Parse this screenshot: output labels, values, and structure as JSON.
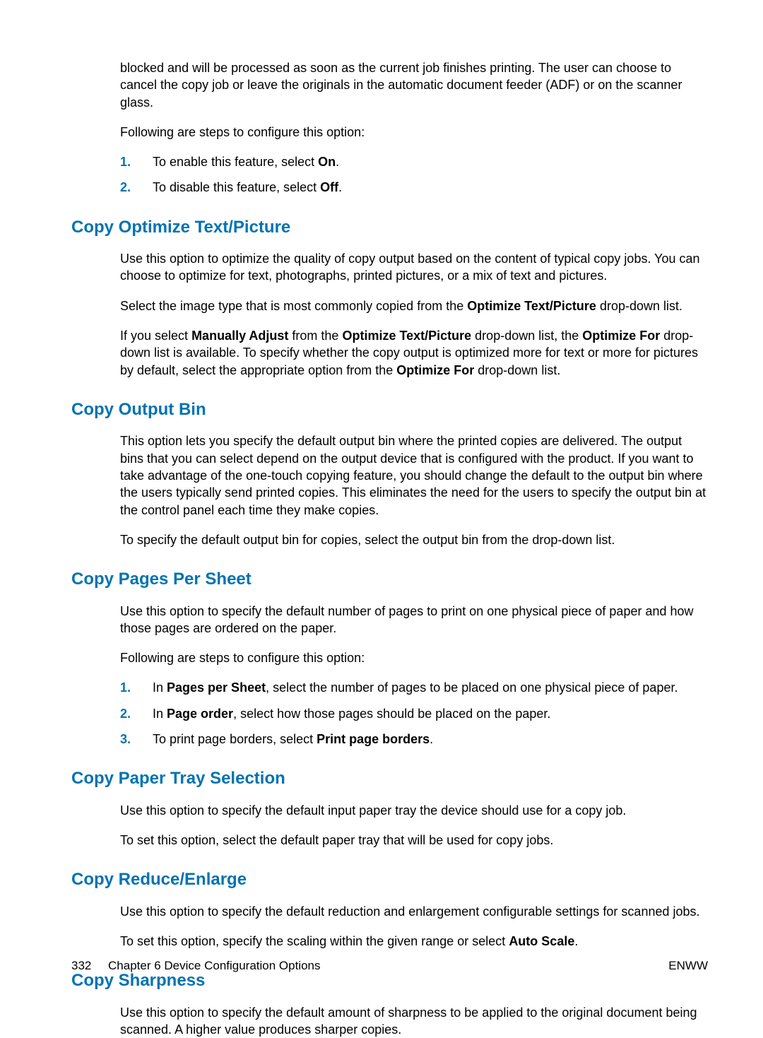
{
  "intro": {
    "p1": "blocked and will be processed as soon as the current job finishes printing. The user can choose to cancel the copy job or leave the originals in the automatic document feeder (ADF) or on the scanner glass.",
    "p2": "Following are steps to configure this option:",
    "li1_a": "To enable this feature, select ",
    "li1_b": "On",
    "li1_c": ".",
    "li2_a": "To disable this feature, select ",
    "li2_b": "Off",
    "li2_c": "."
  },
  "sec1": {
    "title": "Copy Optimize Text/Picture",
    "p1": "Use this option to optimize the quality of copy output based on the content of typical copy jobs. You can choose to optimize for text, photographs, printed pictures, or a mix of text and pictures.",
    "p2_a": "Select the image type that is most commonly copied from the ",
    "p2_b": "Optimize Text/Picture",
    "p2_c": " drop-down list.",
    "p3_a": "If you select ",
    "p3_b": "Manually Adjust",
    "p3_c": " from the ",
    "p3_d": "Optimize Text/Picture",
    "p3_e": " drop-down list, the ",
    "p3_f": "Optimize For",
    "p3_g": " drop-down list is available. To specify whether the copy output is optimized more for text or more for pictures by default, select the appropriate option from the ",
    "p3_h": "Optimize For",
    "p3_i": " drop-down list."
  },
  "sec2": {
    "title": "Copy Output Bin",
    "p1": "This option lets you specify the default output bin where the printed copies are delivered. The output bins that you can select depend on the output device that is configured with the product. If you want to take advantage of the one-touch copying feature, you should change the default to the output bin where the users typically send printed copies. This eliminates the need for the users to specify the output bin at the control panel each time they make copies.",
    "p2": "To specify the default output bin for copies, select the output bin from the drop-down list."
  },
  "sec3": {
    "title": "Copy Pages Per Sheet",
    "p1": "Use this option to specify the default number of pages to print on one physical piece of paper and how those pages are ordered on the paper.",
    "p2": "Following are steps to configure this option:",
    "li1_a": "In ",
    "li1_b": "Pages per Sheet",
    "li1_c": ", select the number of pages to be placed on one physical piece of paper.",
    "li2_a": "In ",
    "li2_b": "Page order",
    "li2_c": ", select how those pages should be placed on the paper.",
    "li3_a": "To print page borders, select ",
    "li3_b": "Print page borders",
    "li3_c": "."
  },
  "sec4": {
    "title": "Copy Paper Tray Selection",
    "p1": "Use this option to specify the default input paper tray the device should use for a copy job.",
    "p2": "To set this option, select the default paper tray that will be used for copy jobs."
  },
  "sec5": {
    "title": "Copy Reduce/Enlarge",
    "p1": "Use this option to specify the default reduction and enlargement configurable settings for scanned jobs.",
    "p2_a": "To set this option, specify the scaling within the given range or select ",
    "p2_b": "Auto Scale",
    "p2_c": "."
  },
  "sec6": {
    "title": "Copy Sharpness",
    "p1": "Use this option to specify the default amount of sharpness to be applied to the original document being scanned. A higher value produces sharper copies."
  },
  "nums": {
    "n1": "1.",
    "n2": "2.",
    "n3": "3."
  },
  "footer": {
    "page": "332",
    "chapter": "Chapter 6   Device Configuration Options",
    "right": "ENWW"
  }
}
